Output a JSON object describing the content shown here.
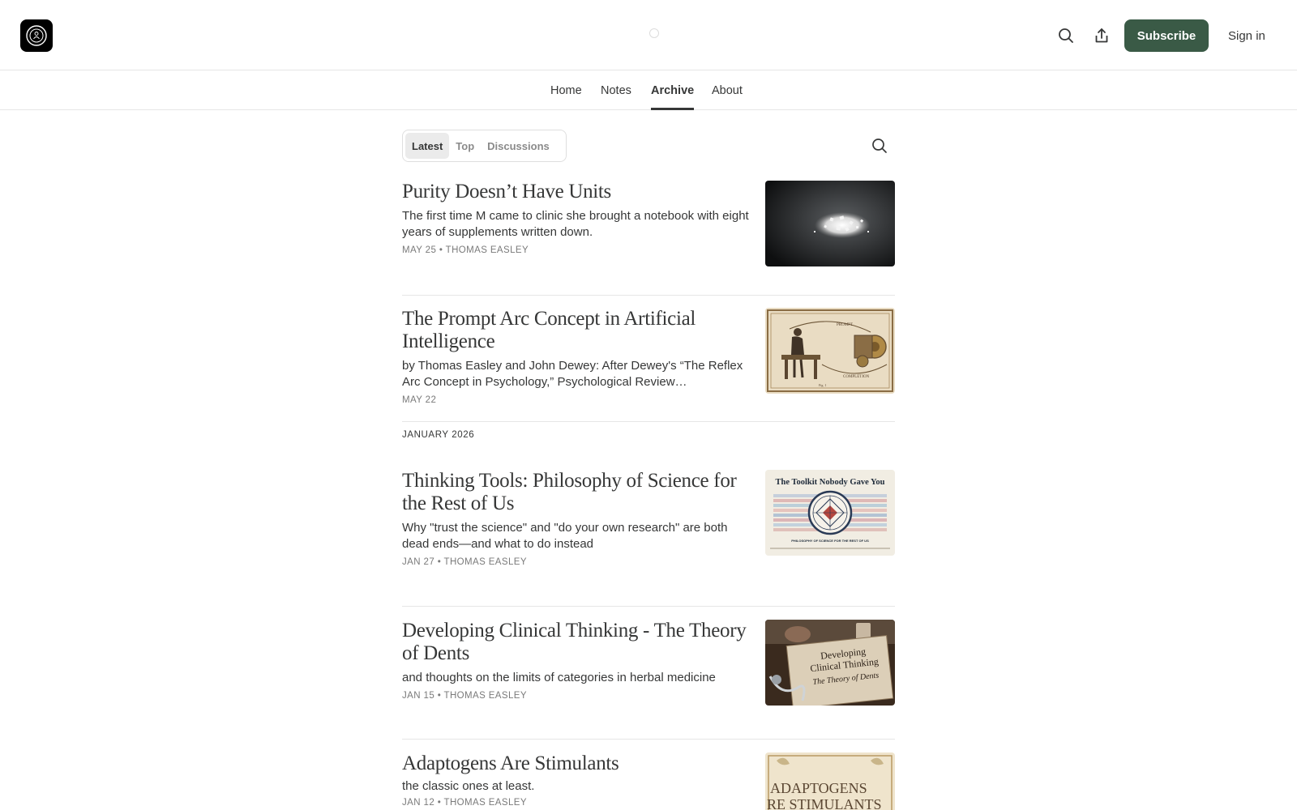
{
  "header": {
    "logo_icon": "publication-logo-icon",
    "search_icon": "search-icon",
    "share_icon": "share-icon",
    "subscribe_label": "Subscribe",
    "signin_label": "Sign in",
    "accent_color": "#3a5a46"
  },
  "nav": {
    "items": [
      {
        "label": "Home"
      },
      {
        "label": "Notes"
      },
      {
        "label": "Archive",
        "active": true
      },
      {
        "label": "About"
      }
    ]
  },
  "archive": {
    "tabs": [
      {
        "label": "Latest",
        "active": true
      },
      {
        "label": "Top"
      },
      {
        "label": "Discussions"
      }
    ],
    "search_icon": "search-icon",
    "month_label": "JANUARY 2026",
    "posts": [
      {
        "title": "Purity Doesn’t Have Units",
        "subtitle": "The first time M came to clinic she brought a notebook with eight years of supplements written down.",
        "date": "MAY 25",
        "author": "THOMAS EASLEY"
      },
      {
        "title": "The Prompt Arc Concept in Artificial Intelligence",
        "subtitle": "by Thomas Easley and John Dewey: After Dewey's “The Reflex Arc Concept in Psychology,” Psychological Review…",
        "date": "MAY 22",
        "author": "",
        "thumb_labels": [
          "PROMPT",
          "COMPLETION",
          "Fig. 1"
        ]
      },
      {
        "title": "Thinking Tools: Philosophy of Science for the Rest of Us",
        "subtitle": "Why \"trust the science\" and \"do your own research\" are both dead ends—and what to do instead",
        "date": "JAN 27",
        "author": "THOMAS EASLEY",
        "thumb_title": "The Toolkit Nobody Gave You",
        "thumb_caption": "PHILOSOPHY OF SCIENCE FOR THE REST OF US"
      },
      {
        "title": "Developing Clinical Thinking - The Theory of Dents",
        "subtitle": "and thoughts on the limits of categories in herbal medicine",
        "date": "JAN 15",
        "author": "THOMAS EASLEY",
        "thumb_title_1": "Developing",
        "thumb_title_2": "Clinical Thinking",
        "thumb_title_3": "The Theory of Dents"
      },
      {
        "title": "Adaptogens Are Stimulants",
        "subtitle": "the classic ones at least.",
        "date": "JAN 12",
        "author": "THOMAS EASLEY",
        "thumb_title_1": "ADAPTOGENS",
        "thumb_title_2": "RE STIMULANTS"
      }
    ]
  }
}
